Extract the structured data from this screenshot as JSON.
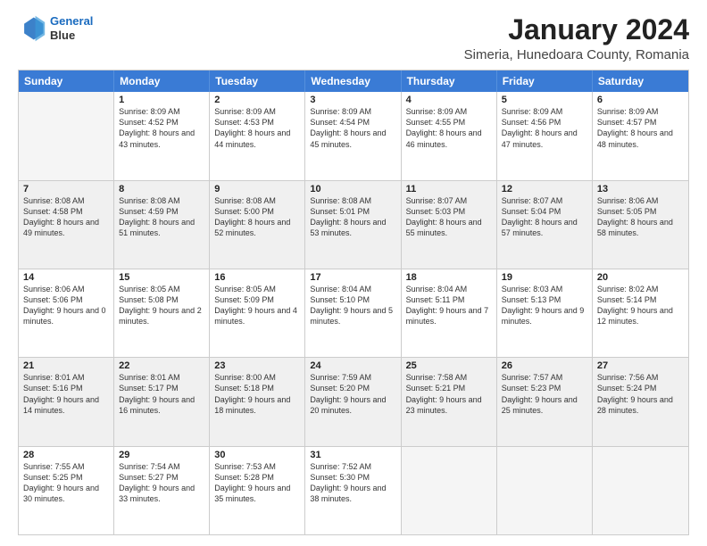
{
  "header": {
    "logo_line1": "General",
    "logo_line2": "Blue",
    "title": "January 2024",
    "subtitle": "Simeria, Hunedoara County, Romania"
  },
  "calendar": {
    "days": [
      "Sunday",
      "Monday",
      "Tuesday",
      "Wednesday",
      "Thursday",
      "Friday",
      "Saturday"
    ],
    "rows": [
      [
        {
          "day": "",
          "empty": true
        },
        {
          "day": "1",
          "sunrise": "Sunrise: 8:09 AM",
          "sunset": "Sunset: 4:52 PM",
          "daylight": "Daylight: 8 hours and 43 minutes."
        },
        {
          "day": "2",
          "sunrise": "Sunrise: 8:09 AM",
          "sunset": "Sunset: 4:53 PM",
          "daylight": "Daylight: 8 hours and 44 minutes."
        },
        {
          "day": "3",
          "sunrise": "Sunrise: 8:09 AM",
          "sunset": "Sunset: 4:54 PM",
          "daylight": "Daylight: 8 hours and 45 minutes."
        },
        {
          "day": "4",
          "sunrise": "Sunrise: 8:09 AM",
          "sunset": "Sunset: 4:55 PM",
          "daylight": "Daylight: 8 hours and 46 minutes."
        },
        {
          "day": "5",
          "sunrise": "Sunrise: 8:09 AM",
          "sunset": "Sunset: 4:56 PM",
          "daylight": "Daylight: 8 hours and 47 minutes."
        },
        {
          "day": "6",
          "sunrise": "Sunrise: 8:09 AM",
          "sunset": "Sunset: 4:57 PM",
          "daylight": "Daylight: 8 hours and 48 minutes."
        }
      ],
      [
        {
          "day": "7",
          "sunrise": "Sunrise: 8:08 AM",
          "sunset": "Sunset: 4:58 PM",
          "daylight": "Daylight: 8 hours and 49 minutes."
        },
        {
          "day": "8",
          "sunrise": "Sunrise: 8:08 AM",
          "sunset": "Sunset: 4:59 PM",
          "daylight": "Daylight: 8 hours and 51 minutes."
        },
        {
          "day": "9",
          "sunrise": "Sunrise: 8:08 AM",
          "sunset": "Sunset: 5:00 PM",
          "daylight": "Daylight: 8 hours and 52 minutes."
        },
        {
          "day": "10",
          "sunrise": "Sunrise: 8:08 AM",
          "sunset": "Sunset: 5:01 PM",
          "daylight": "Daylight: 8 hours and 53 minutes."
        },
        {
          "day": "11",
          "sunrise": "Sunrise: 8:07 AM",
          "sunset": "Sunset: 5:03 PM",
          "daylight": "Daylight: 8 hours and 55 minutes."
        },
        {
          "day": "12",
          "sunrise": "Sunrise: 8:07 AM",
          "sunset": "Sunset: 5:04 PM",
          "daylight": "Daylight: 8 hours and 57 minutes."
        },
        {
          "day": "13",
          "sunrise": "Sunrise: 8:06 AM",
          "sunset": "Sunset: 5:05 PM",
          "daylight": "Daylight: 8 hours and 58 minutes."
        }
      ],
      [
        {
          "day": "14",
          "sunrise": "Sunrise: 8:06 AM",
          "sunset": "Sunset: 5:06 PM",
          "daylight": "Daylight: 9 hours and 0 minutes."
        },
        {
          "day": "15",
          "sunrise": "Sunrise: 8:05 AM",
          "sunset": "Sunset: 5:08 PM",
          "daylight": "Daylight: 9 hours and 2 minutes."
        },
        {
          "day": "16",
          "sunrise": "Sunrise: 8:05 AM",
          "sunset": "Sunset: 5:09 PM",
          "daylight": "Daylight: 9 hours and 4 minutes."
        },
        {
          "day": "17",
          "sunrise": "Sunrise: 8:04 AM",
          "sunset": "Sunset: 5:10 PM",
          "daylight": "Daylight: 9 hours and 5 minutes."
        },
        {
          "day": "18",
          "sunrise": "Sunrise: 8:04 AM",
          "sunset": "Sunset: 5:11 PM",
          "daylight": "Daylight: 9 hours and 7 minutes."
        },
        {
          "day": "19",
          "sunrise": "Sunrise: 8:03 AM",
          "sunset": "Sunset: 5:13 PM",
          "daylight": "Daylight: 9 hours and 9 minutes."
        },
        {
          "day": "20",
          "sunrise": "Sunrise: 8:02 AM",
          "sunset": "Sunset: 5:14 PM",
          "daylight": "Daylight: 9 hours and 12 minutes."
        }
      ],
      [
        {
          "day": "21",
          "sunrise": "Sunrise: 8:01 AM",
          "sunset": "Sunset: 5:16 PM",
          "daylight": "Daylight: 9 hours and 14 minutes."
        },
        {
          "day": "22",
          "sunrise": "Sunrise: 8:01 AM",
          "sunset": "Sunset: 5:17 PM",
          "daylight": "Daylight: 9 hours and 16 minutes."
        },
        {
          "day": "23",
          "sunrise": "Sunrise: 8:00 AM",
          "sunset": "Sunset: 5:18 PM",
          "daylight": "Daylight: 9 hours and 18 minutes."
        },
        {
          "day": "24",
          "sunrise": "Sunrise: 7:59 AM",
          "sunset": "Sunset: 5:20 PM",
          "daylight": "Daylight: 9 hours and 20 minutes."
        },
        {
          "day": "25",
          "sunrise": "Sunrise: 7:58 AM",
          "sunset": "Sunset: 5:21 PM",
          "daylight": "Daylight: 9 hours and 23 minutes."
        },
        {
          "day": "26",
          "sunrise": "Sunrise: 7:57 AM",
          "sunset": "Sunset: 5:23 PM",
          "daylight": "Daylight: 9 hours and 25 minutes."
        },
        {
          "day": "27",
          "sunrise": "Sunrise: 7:56 AM",
          "sunset": "Sunset: 5:24 PM",
          "daylight": "Daylight: 9 hours and 28 minutes."
        }
      ],
      [
        {
          "day": "28",
          "sunrise": "Sunrise: 7:55 AM",
          "sunset": "Sunset: 5:25 PM",
          "daylight": "Daylight: 9 hours and 30 minutes."
        },
        {
          "day": "29",
          "sunrise": "Sunrise: 7:54 AM",
          "sunset": "Sunset: 5:27 PM",
          "daylight": "Daylight: 9 hours and 33 minutes."
        },
        {
          "day": "30",
          "sunrise": "Sunrise: 7:53 AM",
          "sunset": "Sunset: 5:28 PM",
          "daylight": "Daylight: 9 hours and 35 minutes."
        },
        {
          "day": "31",
          "sunrise": "Sunrise: 7:52 AM",
          "sunset": "Sunset: 5:30 PM",
          "daylight": "Daylight: 9 hours and 38 minutes."
        },
        {
          "day": "",
          "empty": true
        },
        {
          "day": "",
          "empty": true
        },
        {
          "day": "",
          "empty": true
        }
      ]
    ]
  }
}
